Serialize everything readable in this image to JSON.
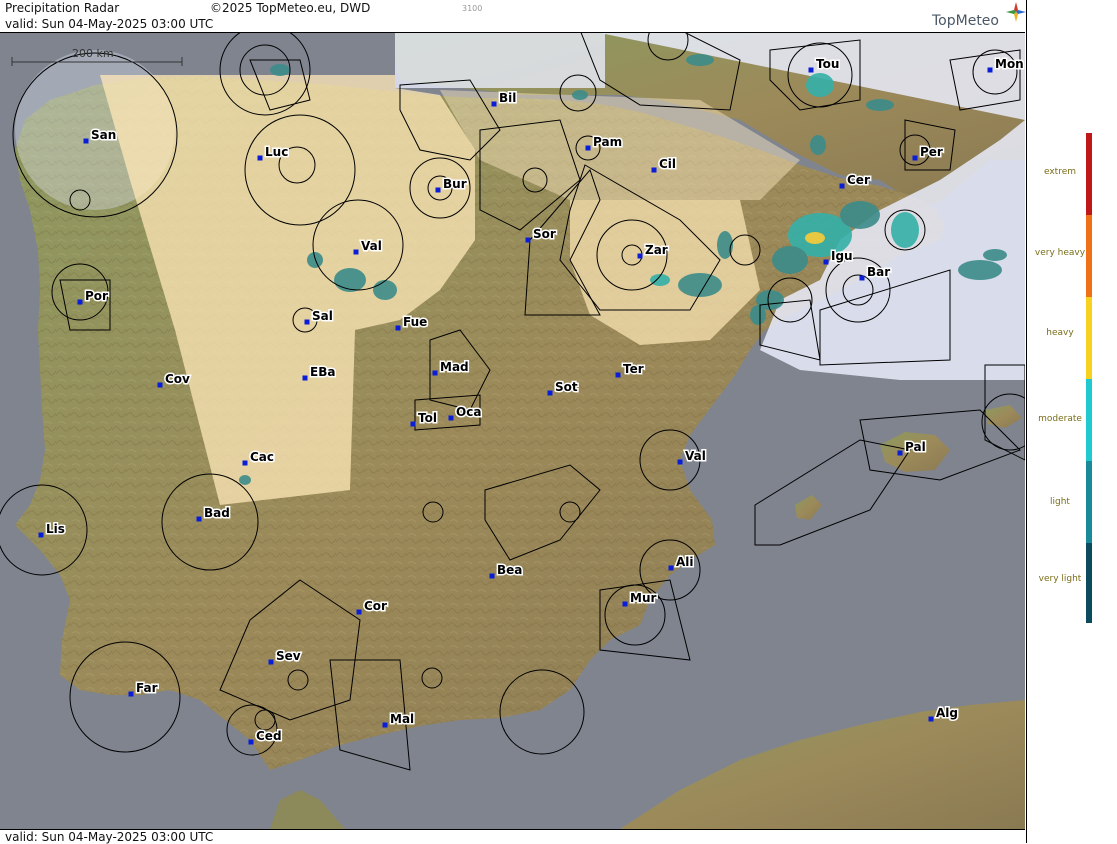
{
  "header": {
    "title": "Precipitation Radar",
    "copyright": "©2025 TopMeteo.eu, DWD",
    "code": "3100",
    "valid": "valid:  Sun  04-May-2025 03:00 UTC",
    "brand": "TopMeteo"
  },
  "footer": {
    "valid": "valid:  Sun  04-May-2025 03:00 UTC"
  },
  "scale_bar": {
    "label": "200 km"
  },
  "legend": {
    "items": [
      {
        "label": "extrem",
        "color": "#c01818"
      },
      {
        "label": "very heavy",
        "color": "#f07018"
      },
      {
        "label": "heavy",
        "color": "#f8d020"
      },
      {
        "label": "moderate",
        "color": "#20c8d0"
      },
      {
        "label": "light",
        "color": "#1a8a98"
      },
      {
        "label": "very light",
        "color": "#0c4a5e"
      }
    ]
  },
  "cities": [
    {
      "name": "San"
    },
    {
      "name": "Luc"
    },
    {
      "name": "Bil"
    },
    {
      "name": "Pam"
    },
    {
      "name": "Tou"
    },
    {
      "name": "Mon"
    },
    {
      "name": "Per"
    },
    {
      "name": "Cil"
    },
    {
      "name": "Cer"
    },
    {
      "name": "Bur"
    },
    {
      "name": "Val"
    },
    {
      "name": "Sor"
    },
    {
      "name": "Zar"
    },
    {
      "name": "Igu"
    },
    {
      "name": "Bar"
    },
    {
      "name": "Por"
    },
    {
      "name": "Sal"
    },
    {
      "name": "Fue"
    },
    {
      "name": "Mad"
    },
    {
      "name": "Ter"
    },
    {
      "name": "Cov"
    },
    {
      "name": "EBa"
    },
    {
      "name": "Sot"
    },
    {
      "name": "Tol"
    },
    {
      "name": "Oca"
    },
    {
      "name": "Pal"
    },
    {
      "name": "Cac"
    },
    {
      "name": "Val"
    },
    {
      "name": "Bad"
    },
    {
      "name": "Lis"
    },
    {
      "name": "Ali"
    },
    {
      "name": "Bea"
    },
    {
      "name": "Cor"
    },
    {
      "name": "Mur"
    },
    {
      "name": "Sev"
    },
    {
      "name": "Far"
    },
    {
      "name": "Mal"
    },
    {
      "name": "Ced"
    },
    {
      "name": "Alg"
    }
  ],
  "colors": {
    "sea": "#7f848f",
    "land": "#9a8a5e",
    "overlay_light": "#eef0fb",
    "coverage": "#ffe6b0",
    "station": "#0a1ed8",
    "precip_very_light": "#3c8c8a",
    "precip_light": "#34b0a8",
    "precip_moderate": "#40d8d8"
  }
}
